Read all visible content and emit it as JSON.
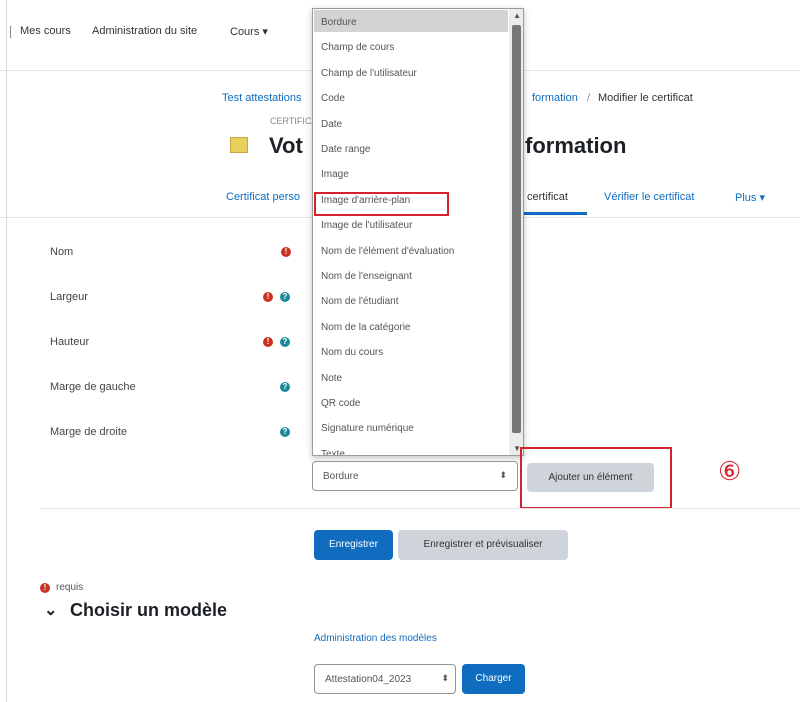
{
  "nav": {
    "my_courses": "Mes cours",
    "site_admin": "Administration du site",
    "courses": "Cours ▾"
  },
  "breadcrumb": {
    "course": "Test attestations",
    "formation": "formation",
    "separator": "/",
    "current": "Modifier le certificat"
  },
  "header": {
    "subtitle": "CERTIFICA",
    "title_left": "Vot",
    "title_right": "formation"
  },
  "tabs": {
    "custom_certificate": "Certificat perso",
    "certificate": "certificat",
    "verify": "Vérifier le certificat",
    "more": "Plus ▾"
  },
  "form": {
    "name": "Nom",
    "width": "Largeur",
    "height": "Hauteur",
    "left_margin": "Marge de gauche",
    "right_margin": "Marge de droite"
  },
  "dropdown": {
    "options": [
      "Bordure",
      "Champ de cours",
      "Champ de l'utilisateur",
      "Code",
      "Date",
      "Date range",
      "Image",
      "Image d'arrière-plan",
      "Image de l'utilisateur",
      "Nom de l'élément d'évaluation",
      "Nom de l'enseignant",
      "Nom de l'étudiant",
      "Nom de la catégorie",
      "Nom du cours",
      "Note",
      "QR code",
      "Signature numérique",
      "Texte"
    ],
    "selected": "Bordure",
    "highlighted": "Image d'arrière-plan"
  },
  "element_select": {
    "value": "Bordure",
    "caret": "⬍"
  },
  "add_element_button": "Ajouter un élément",
  "step_marker": "⑥",
  "save_button": "Enregistrer",
  "save_preview_button": "Enregistrer et prévisualiser",
  "required_note": "requis",
  "choose_template": {
    "chevron": "⌄",
    "heading": "Choisir un modèle",
    "admin_link": "Administration des modèles",
    "template_value": "Attestation04_2023",
    "template_caret": "⬍",
    "load_button": "Charger"
  },
  "colors": {
    "primary": "#0f6cbf",
    "required": "#ca3120",
    "help": "#1a8a9a",
    "highlight_border": "#d2232f"
  }
}
